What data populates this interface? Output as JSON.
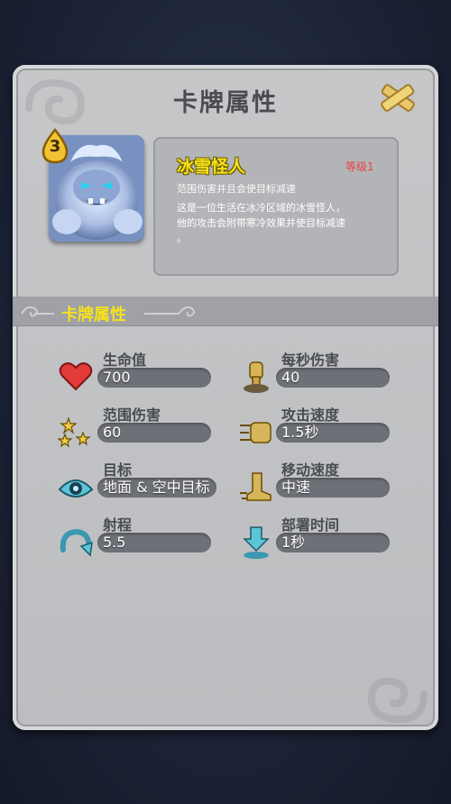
{
  "screen": {
    "title": "卡牌属性",
    "close_icon": "close-crossed-scrolls-icon"
  },
  "card": {
    "elixir_cost": "3",
    "name": "冰雪怪人",
    "level": "等级1",
    "subtitle": "范围伤害并且会使目标减速",
    "description_line1": "这是一位生活在冰冷区域的冰雪怪人，",
    "description_line2": "他的攻击会附带寒冷效果并使目标减速",
    "description_line3": "。"
  },
  "section": {
    "title": "卡牌属性"
  },
  "stats": {
    "hitpoints": {
      "label": "生命值",
      "value": "700",
      "icon": "heart-icon"
    },
    "dps": {
      "label": "每秒伤害",
      "value": "40",
      "icon": "fist-damage-icon"
    },
    "area_damage": {
      "label": "范围伤害",
      "value": "60",
      "icon": "splash-stars-icon"
    },
    "hit_speed": {
      "label": "攻击速度",
      "value": "1.5秒",
      "icon": "punch-speed-icon"
    },
    "targets": {
      "label": "目标",
      "value": "地面 & 空中目标",
      "icon": "target-eye-icon"
    },
    "speed": {
      "label": "移动速度",
      "value": "中速",
      "icon": "boot-speed-icon"
    },
    "range": {
      "label": "射程",
      "value": "5.5",
      "icon": "range-arc-icon"
    },
    "deploy_time": {
      "label": "部署时间",
      "value": "1秒",
      "icon": "deploy-arrow-icon"
    }
  },
  "colors": {
    "accent_yellow": "#f6e21b",
    "level_red": "#e24545",
    "panel_gray": "#c2c3c6",
    "field_dark": "#6e7077",
    "background_navy": "#1d2438"
  }
}
